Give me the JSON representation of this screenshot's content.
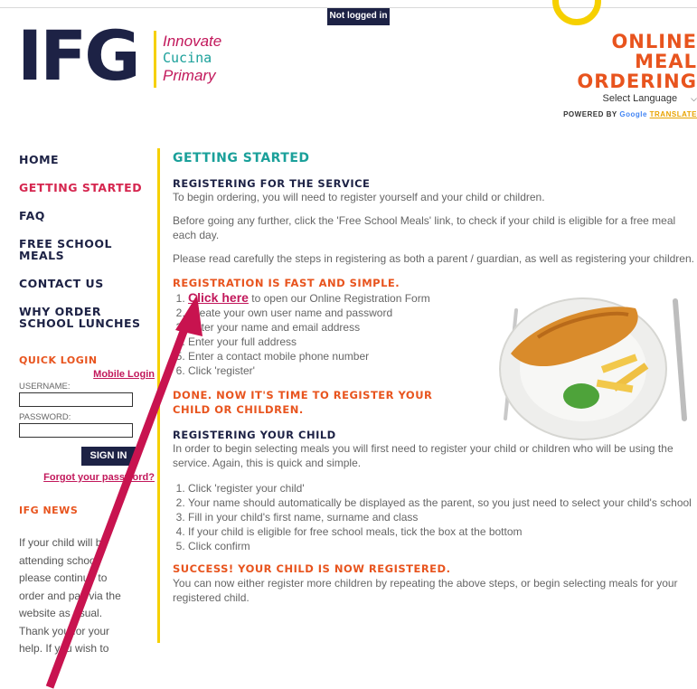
{
  "header": {
    "status": "Not logged in",
    "logo_main": "IFG",
    "logo_sub": [
      "Innovate",
      "Cucina",
      "Primary"
    ],
    "title_lines": [
      "ONLINE",
      "MEAL",
      "ORDERING"
    ],
    "language_select": "Select Language",
    "powered_by": "POWERED BY",
    "google": "Google",
    "translate": "TRANSLATE"
  },
  "sidebar": {
    "nav": [
      "HOME",
      "GETTING STARTED",
      "FAQ",
      "FREE SCHOOL MEALS",
      "CONTACT US",
      "WHY ORDER SCHOOL LUNCHES"
    ],
    "active_index": 1,
    "quick_login": "QUICK LOGIN",
    "mobile_login": "Mobile Login",
    "username_label": "USERNAME:",
    "password_label": "PASSWORD:",
    "sign_in": "SIGN IN",
    "forgot": "Forgot your password?",
    "news_heading": "IFG NEWS",
    "news_text": "If your child will be attending school, please continue to order and pay via the website as usual. Thank you for your help. If you wish to"
  },
  "content": {
    "title": "GETTING STARTED",
    "registering_heading": "REGISTERING FOR THE SERVICE",
    "registering_p1": "To begin ordering, you will need to register yourself and your child or children.",
    "registering_p2": "Before going any further, click the 'Free School Meals' link, to check if your child is eligible for a free meal each day.",
    "registering_p3": "Please read carefully the steps in registering as both a parent / guardian, as well as registering your children.",
    "fast_heading": "REGISTRATION IS FAST AND SIMPLE.",
    "click_here": "Click here",
    "click_here_rest": " to open our Online Registration Form",
    "steps": [
      "Create your own user name and password",
      "Enter your name and email address",
      "Enter your full address",
      "Enter a contact mobile phone number",
      "Click 'register'"
    ],
    "done_heading": "DONE. NOW IT'S TIME TO REGISTER YOUR CHILD OR CHILDREN.",
    "child_heading": "REGISTERING YOUR CHILD",
    "child_p": "In order to begin selecting meals you will first need to register your child or children who will be using the service. Again, this is quick and simple.",
    "child_steps": [
      "Click 'register your child'",
      "Your name should automatically be displayed as the parent, so you just need to select your child's school",
      "Fill in your child's first name, surname and class",
      "If your child is eligible for free school meals, tick the box at the bottom",
      "Click confirm"
    ],
    "success_heading": "SUCCESS! YOUR CHILD IS NOW REGISTERED.",
    "success_p": "You can now either register more children by repeating the above steps, or begin selecting meals for your registered child."
  },
  "colors": {
    "navy": "#1d2245",
    "pink": "#c2185b",
    "orange": "#e8541e",
    "teal": "#1aa09a",
    "yellow": "#f6d000",
    "arrow": "#c8134f"
  }
}
